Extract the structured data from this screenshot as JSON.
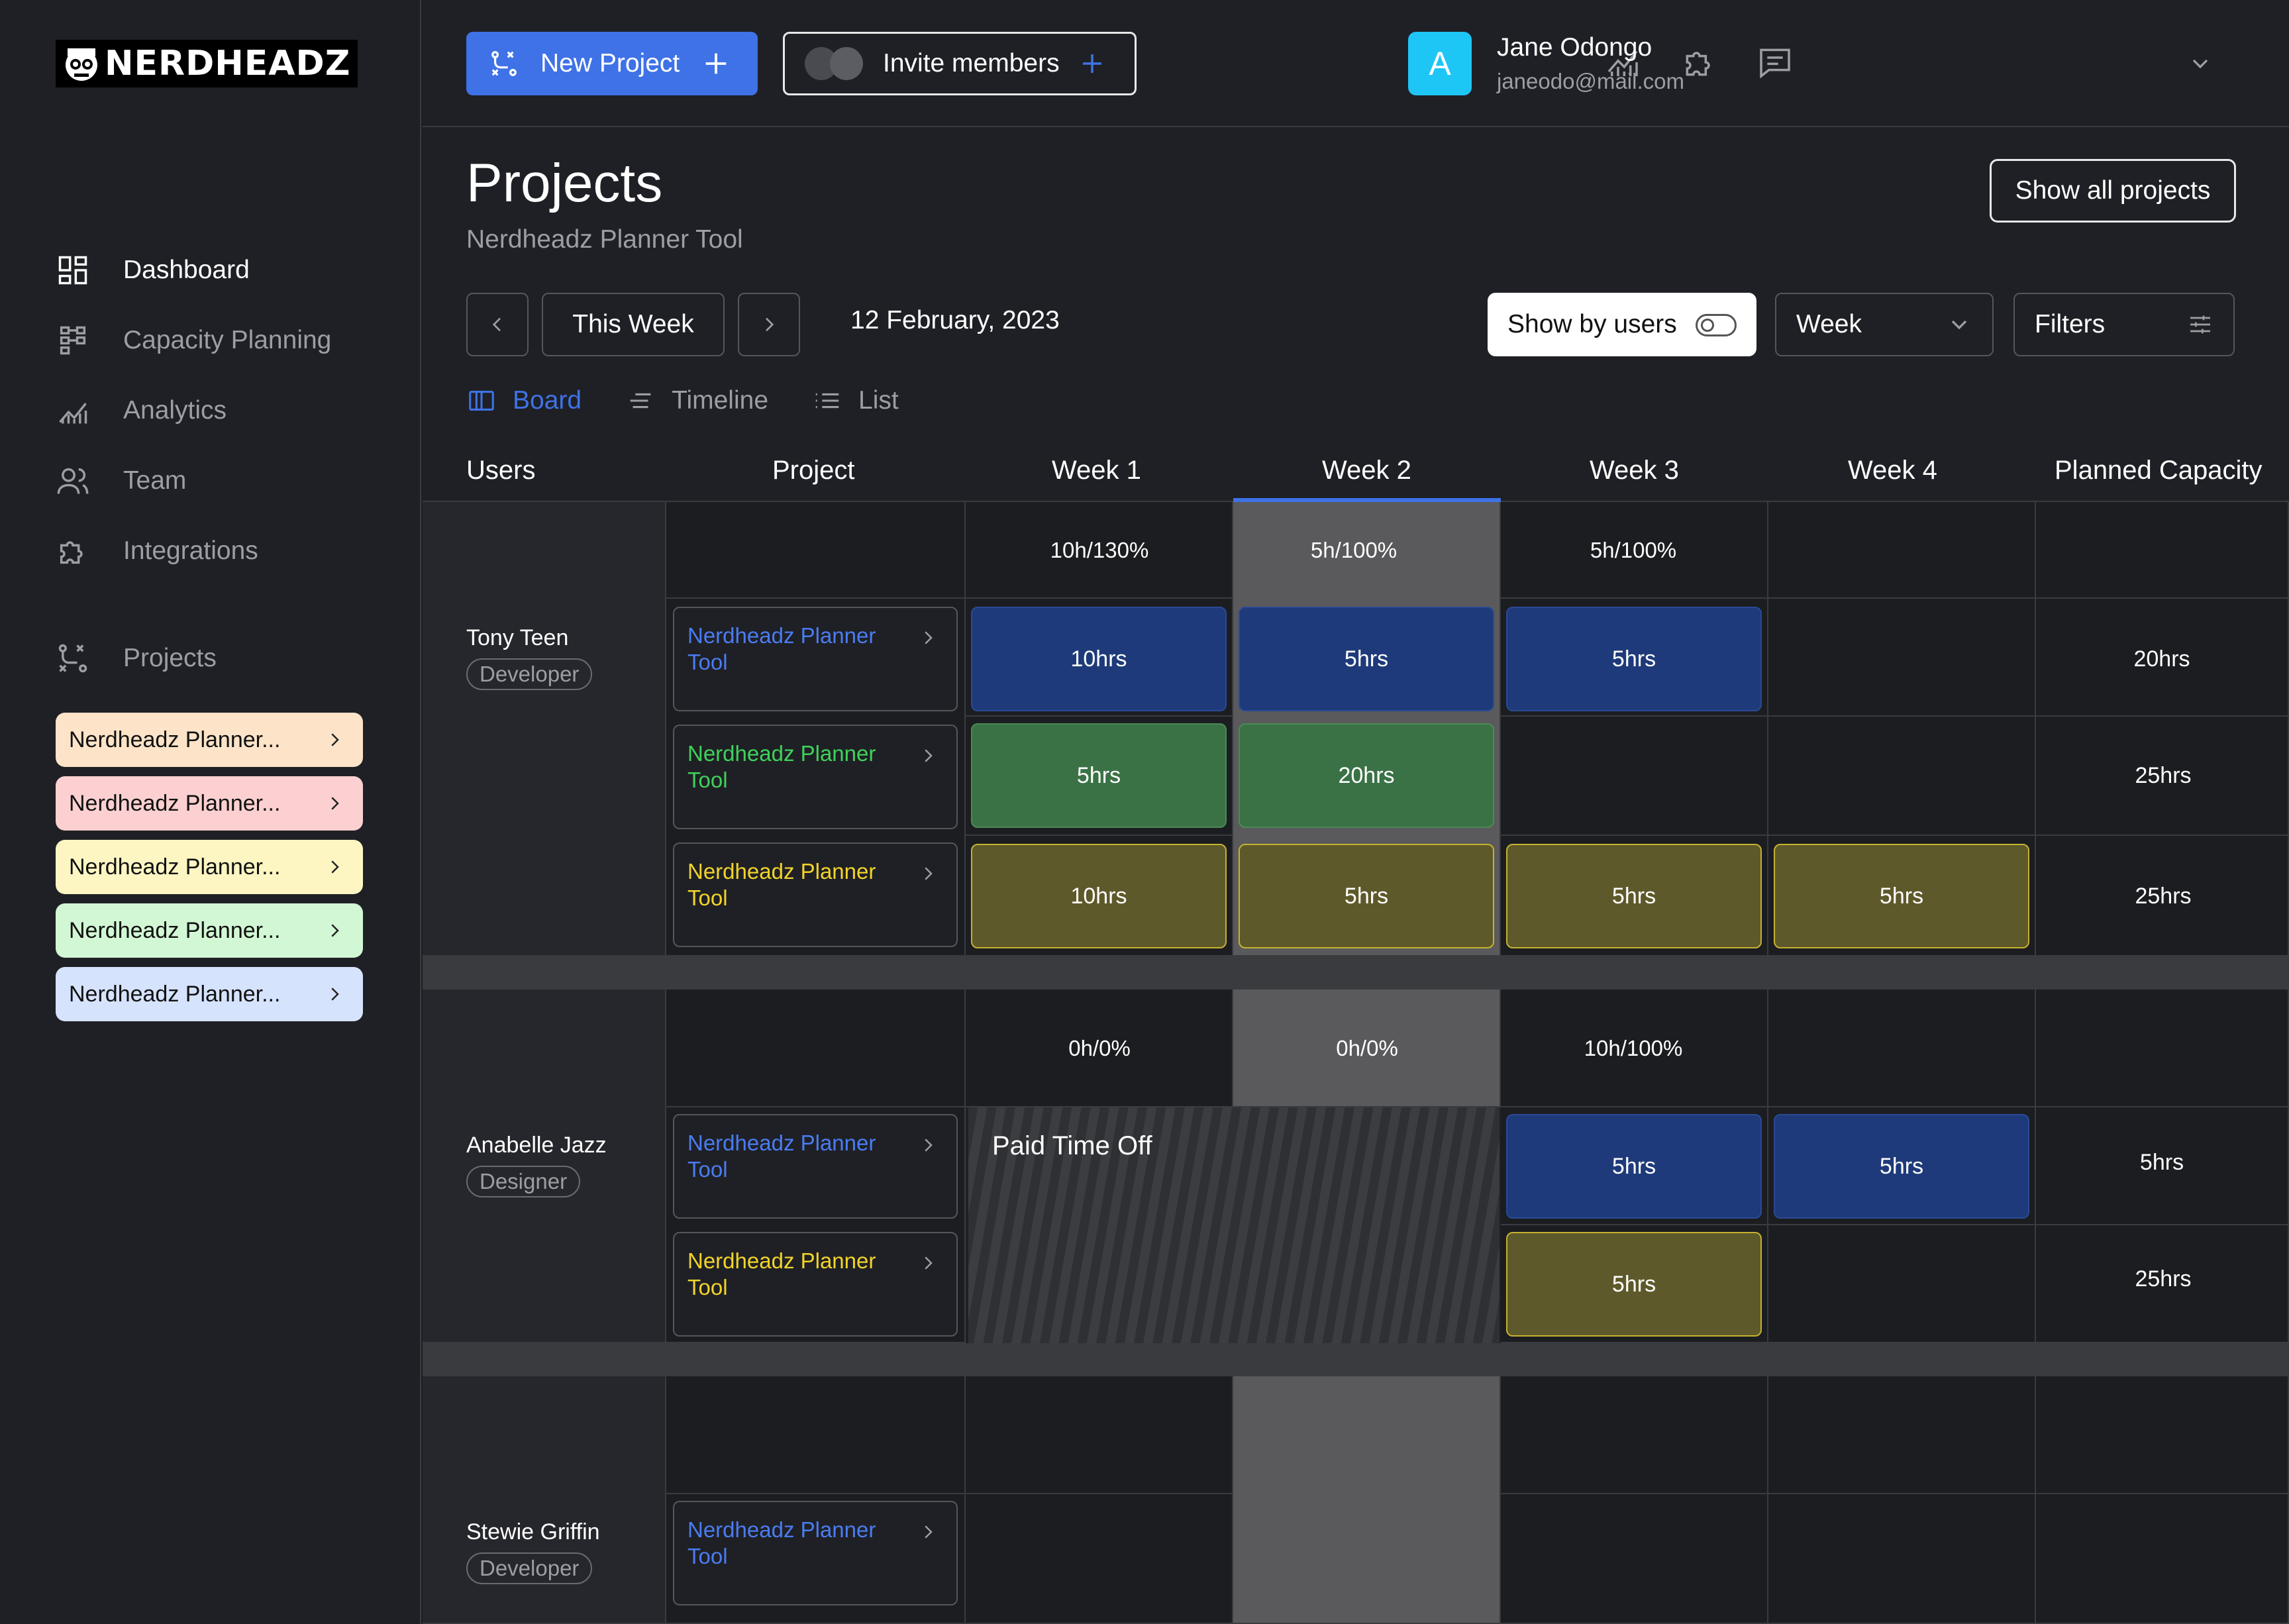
{
  "brand": {
    "name": "NERDHEADZ"
  },
  "sidebar": {
    "nav": [
      {
        "label": "Dashboard",
        "icon": "dashboard-icon",
        "active": true
      },
      {
        "label": "Capacity Planning",
        "icon": "capacity-icon",
        "active": false
      },
      {
        "label": "Analytics",
        "icon": "analytics-icon",
        "active": false
      },
      {
        "label": "Team",
        "icon": "team-icon",
        "active": false
      },
      {
        "label": "Integrations",
        "icon": "puzzle-icon",
        "active": false
      }
    ],
    "projects_label": "Projects",
    "projects": [
      {
        "label": "Nerdheadz Planner...",
        "color": "#fde3c8"
      },
      {
        "label": "Nerdheadz Planner...",
        "color": "#fcd0d0"
      },
      {
        "label": "Nerdheadz Planner...",
        "color": "#fdf6c3"
      },
      {
        "label": "Nerdheadz Planner...",
        "color": "#d2f7d4"
      },
      {
        "label": "Nerdheadz Planner...",
        "color": "#d6e3fd"
      }
    ]
  },
  "topbar": {
    "new_project": "New Project",
    "invite": "Invite members",
    "user": {
      "initial": "A",
      "name": "Jane Odongo",
      "email": "janeodo@mail.com"
    }
  },
  "header": {
    "title": "Projects",
    "subtitle": "Nerdheadz Planner Tool",
    "show_all": "Show all projects",
    "this_week": "This Week",
    "date": "12 February, 2023",
    "show_by_users": "Show by users",
    "period": "Week",
    "filters": "Filters"
  },
  "views": [
    {
      "label": "Board",
      "active": true
    },
    {
      "label": "Timeline",
      "active": false
    },
    {
      "label": "List",
      "active": false
    }
  ],
  "columns": [
    "Users",
    "Project",
    "Week 1",
    "Week 2",
    "Week 3",
    "Week 4",
    "Planned Capacity"
  ],
  "rows": {
    "u1": {
      "name": "Tony Teen",
      "role": "Developer",
      "summary": [
        "10h/130%",
        "5h/100%",
        "5h/100%"
      ],
      "projects": [
        {
          "label": "Nerdheadz Planner Tool",
          "color": "#4a7cf2",
          "blocks": [
            "10hrs",
            "5hrs",
            "5hrs"
          ],
          "capacity": "20hrs"
        },
        {
          "label": "Nerdheadz Planner Tool",
          "color": "#3fd25a",
          "blocks": [
            "5hrs",
            "20hrs"
          ],
          "capacity": "25hrs"
        },
        {
          "label": "Nerdheadz Planner Tool",
          "color": "#f2d42a",
          "blocks": [
            "10hrs",
            "5hrs",
            "5hrs",
            "5hrs"
          ],
          "capacity": "25hrs"
        }
      ]
    },
    "u2": {
      "name": "Anabelle Jazz",
      "role": "Designer",
      "summary": [
        "0h/0%",
        "0h/0%",
        "10h/100%"
      ],
      "pto": "Paid Time Off",
      "projects": [
        {
          "label": "Nerdheadz Planner Tool",
          "color": "#4a7cf2",
          "blocks": [
            "5hrs",
            "5hrs"
          ],
          "capacity": "5hrs"
        },
        {
          "label": "Nerdheadz Planner Tool",
          "color": "#f2d42a",
          "blocks": [
            "5hrs"
          ],
          "capacity": "25hrs"
        }
      ]
    },
    "u3": {
      "name": "Stewie Griffin",
      "role": "Developer",
      "projects": [
        {
          "label": "Nerdheadz Planner Tool",
          "color": "#4a7cf2"
        }
      ]
    }
  }
}
